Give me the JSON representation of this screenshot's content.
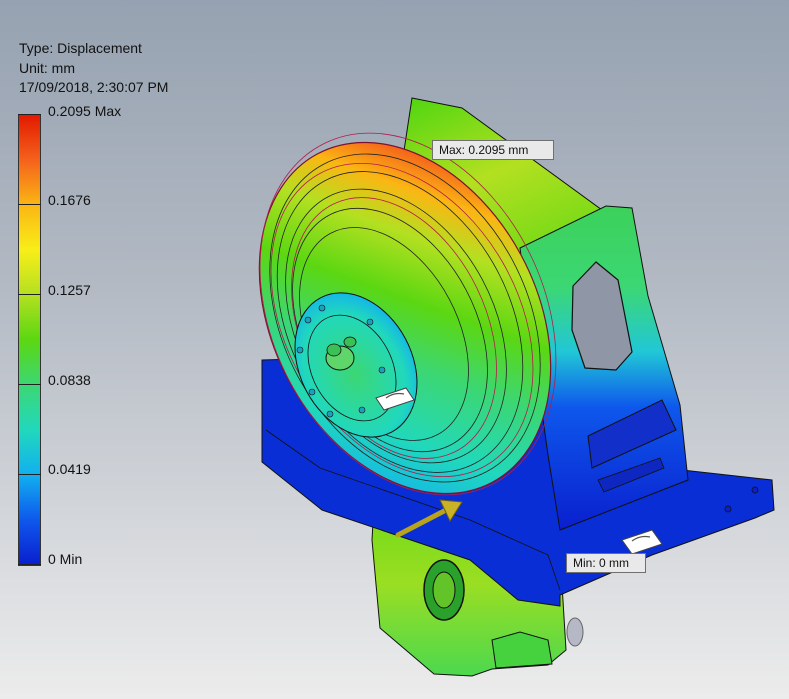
{
  "result": {
    "type_line": "Type: Displacement",
    "unit_line": "Unit: mm",
    "timestamp": "17/09/2018, 2:30:07 PM"
  },
  "legend": {
    "labels": [
      "0.2095 Max",
      "0.1676",
      "0.1257",
      "0.0838",
      "0.0419",
      "0 Min"
    ]
  },
  "probes": {
    "max": "Max: 0.2095 mm",
    "min": "Min: 0 mm"
  },
  "colors": {
    "max": "#e31a00",
    "mid": "#5bd712",
    "min": "#0a1fce"
  }
}
